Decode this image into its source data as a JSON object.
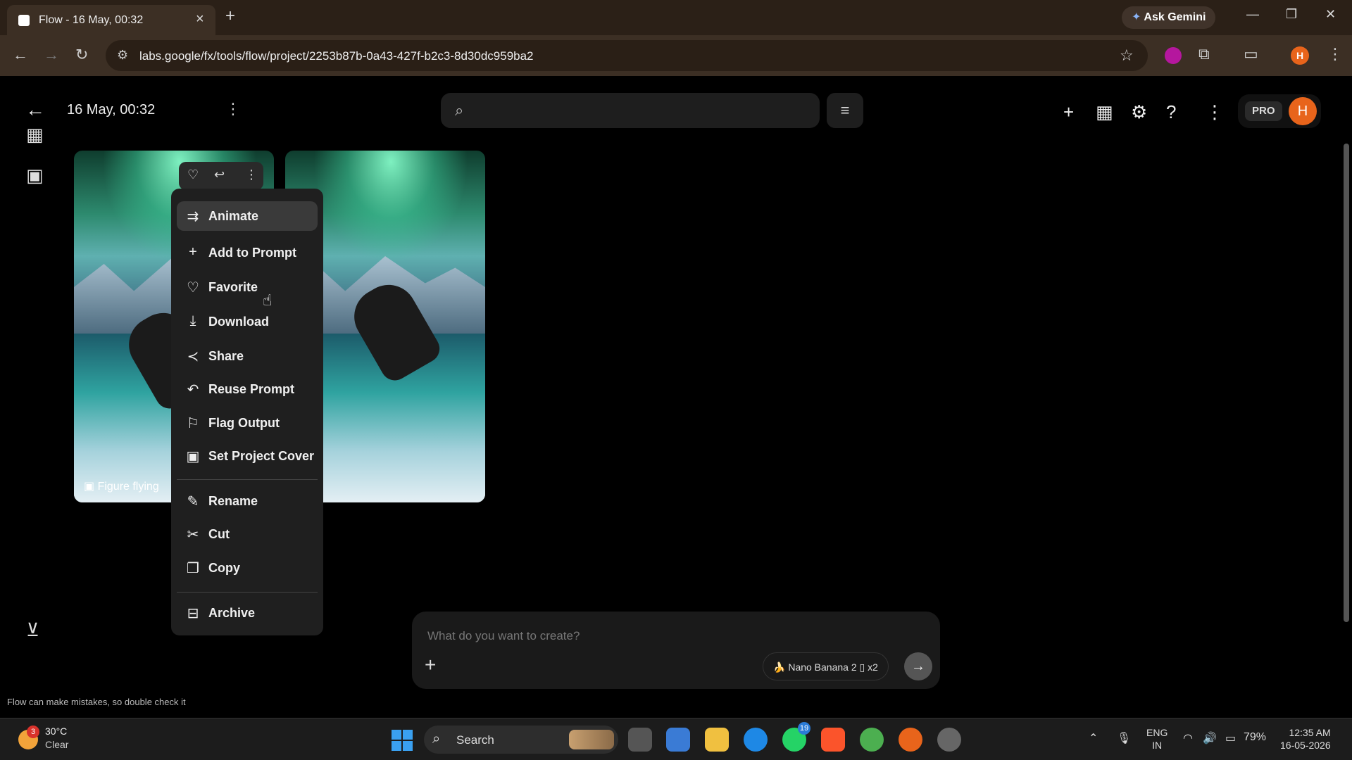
{
  "browser": {
    "tab_title": "Flow - 16 May, 00:32",
    "url": "labs.google/fx/tools/flow/project/2253b87b-0a43-427f-b2c3-8d30dc959ba2",
    "ask_gemini": "Ask Gemini",
    "profile_initial": "H"
  },
  "app": {
    "project_title": "16 May, 00:32",
    "search_placeholder": "",
    "pro_label": "PRO",
    "user_initial": "H"
  },
  "cards": [
    {
      "caption": "Figure flying"
    },
    {
      "caption": ""
    }
  ],
  "context_menu": {
    "items": [
      {
        "label": "Animate",
        "icon": "animate-icon"
      },
      {
        "label": "Add to Prompt",
        "icon": "plus-icon"
      },
      {
        "label": "Favorite",
        "icon": "heart-icon"
      },
      {
        "label": "Download",
        "icon": "download-icon"
      },
      {
        "label": "Share",
        "icon": "share-icon"
      },
      {
        "label": "Reuse Prompt",
        "icon": "undo-icon"
      },
      {
        "label": "Flag Output",
        "icon": "flag-icon"
      },
      {
        "label": "Set Project Cover",
        "icon": "gallery-icon"
      },
      {
        "label": "Rename",
        "icon": "pencil-icon"
      },
      {
        "label": "Cut",
        "icon": "scissors-icon"
      },
      {
        "label": "Copy",
        "icon": "copy-icon"
      },
      {
        "label": "Archive",
        "icon": "archive-icon"
      }
    ]
  },
  "prompt": {
    "placeholder": "What do you want to create?",
    "model": "Nano Banana 2",
    "count": "x2"
  },
  "disclaimer": "Flow can make mistakes, so double check it",
  "taskbar": {
    "temperature": "30°C",
    "condition": "Clear",
    "weather_badge": "3",
    "search_label": "Search",
    "whatsapp_badge": "19",
    "lang_line1": "ENG",
    "lang_line2": "IN",
    "battery": "79%",
    "time": "12:35 AM",
    "date": "16-05-2026"
  }
}
